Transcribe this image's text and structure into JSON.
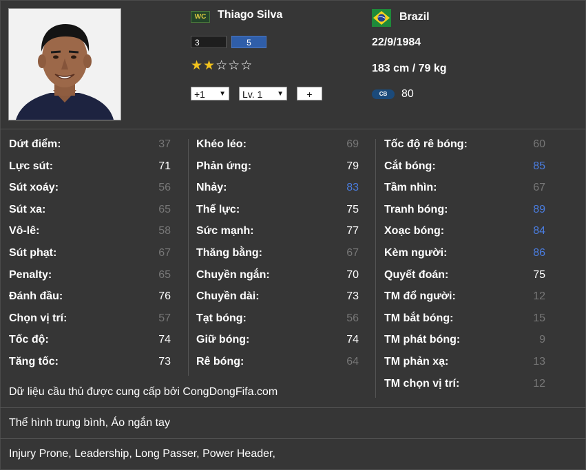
{
  "player": {
    "name": "Thiago Silva",
    "season_badge": "WC",
    "level_left": "3",
    "level_right": "5",
    "stars": 2,
    "max_stars": 5,
    "nation": "Brazil",
    "dob": "22/9/1984",
    "height_weight": "183 cm / 79 kg",
    "position": "CB",
    "overall": "80"
  },
  "controls": {
    "upgrade_select": "+1",
    "level_select": "Lv. 1",
    "add_button": "+"
  },
  "icons": {
    "stars": "star-icon",
    "flag": "brazil-flag-icon",
    "dropdown": "chevron-down-icon"
  },
  "colors": {
    "background": "#363636",
    "stat_low": "#777777",
    "stat_mid": "#ffffff",
    "stat_high": "#4a7de0",
    "star_filled": "#f2c21d",
    "level_bar": "#2f5ea9"
  },
  "stats": {
    "col1": [
      {
        "label": "Dứt điểm:",
        "value": "37",
        "tier": "low"
      },
      {
        "label": "Lực sút:",
        "value": "71",
        "tier": "mid"
      },
      {
        "label": "Sút xoáy:",
        "value": "56",
        "tier": "low"
      },
      {
        "label": "Sút xa:",
        "value": "65",
        "tier": "low"
      },
      {
        "label": "Vô-lê:",
        "value": "58",
        "tier": "low"
      },
      {
        "label": "Sút phạt:",
        "value": "67",
        "tier": "low"
      },
      {
        "label": "Penalty:",
        "value": "65",
        "tier": "low"
      },
      {
        "label": "Đánh đầu:",
        "value": "76",
        "tier": "mid"
      },
      {
        "label": "Chọn vị trí:",
        "value": "57",
        "tier": "low"
      },
      {
        "label": "Tốc độ:",
        "value": "74",
        "tier": "mid"
      },
      {
        "label": "Tăng tốc:",
        "value": "73",
        "tier": "mid"
      }
    ],
    "col2": [
      {
        "label": "Khéo léo:",
        "value": "69",
        "tier": "low"
      },
      {
        "label": "Phản ứng:",
        "value": "79",
        "tier": "mid"
      },
      {
        "label": "Nhảy:",
        "value": "83",
        "tier": "high"
      },
      {
        "label": "Thể lực:",
        "value": "75",
        "tier": "mid"
      },
      {
        "label": "Sức mạnh:",
        "value": "77",
        "tier": "mid"
      },
      {
        "label": "Thăng bằng:",
        "value": "67",
        "tier": "low"
      },
      {
        "label": "Chuyền ngắn:",
        "value": "70",
        "tier": "mid"
      },
      {
        "label": "Chuyền dài:",
        "value": "73",
        "tier": "mid"
      },
      {
        "label": "Tạt bóng:",
        "value": "56",
        "tier": "low"
      },
      {
        "label": "Giữ bóng:",
        "value": "74",
        "tier": "mid"
      },
      {
        "label": "Rê bóng:",
        "value": "64",
        "tier": "low"
      }
    ],
    "col3": [
      {
        "label": "Tốc độ rê bóng:",
        "value": "60",
        "tier": "low"
      },
      {
        "label": "Cắt bóng:",
        "value": "85",
        "tier": "high"
      },
      {
        "label": "Tầm nhìn:",
        "value": "67",
        "tier": "low"
      },
      {
        "label": "Tranh bóng:",
        "value": "89",
        "tier": "high"
      },
      {
        "label": "Xoạc bóng:",
        "value": "84",
        "tier": "high"
      },
      {
        "label": "Kèm người:",
        "value": "86",
        "tier": "high"
      },
      {
        "label": "Quyết đoán:",
        "value": "75",
        "tier": "mid"
      },
      {
        "label": "TM đổ người:",
        "value": "12",
        "tier": "low"
      },
      {
        "label": "TM bắt bóng:",
        "value": "15",
        "tier": "low"
      },
      {
        "label": "TM phát bóng:",
        "value": "9",
        "tier": "low"
      },
      {
        "label": "TM phản xạ:",
        "value": "13",
        "tier": "low"
      },
      {
        "label": "TM chọn vị trí:",
        "value": "12",
        "tier": "low"
      }
    ]
  },
  "credit": "Dữ liệu cầu thủ được cung cấp bởi CongDongFifa.com",
  "body_type": "Thể hình trung bình, Áo ngắn tay",
  "traits": "Injury Prone, Leadership, Long Passer, Power Header,"
}
